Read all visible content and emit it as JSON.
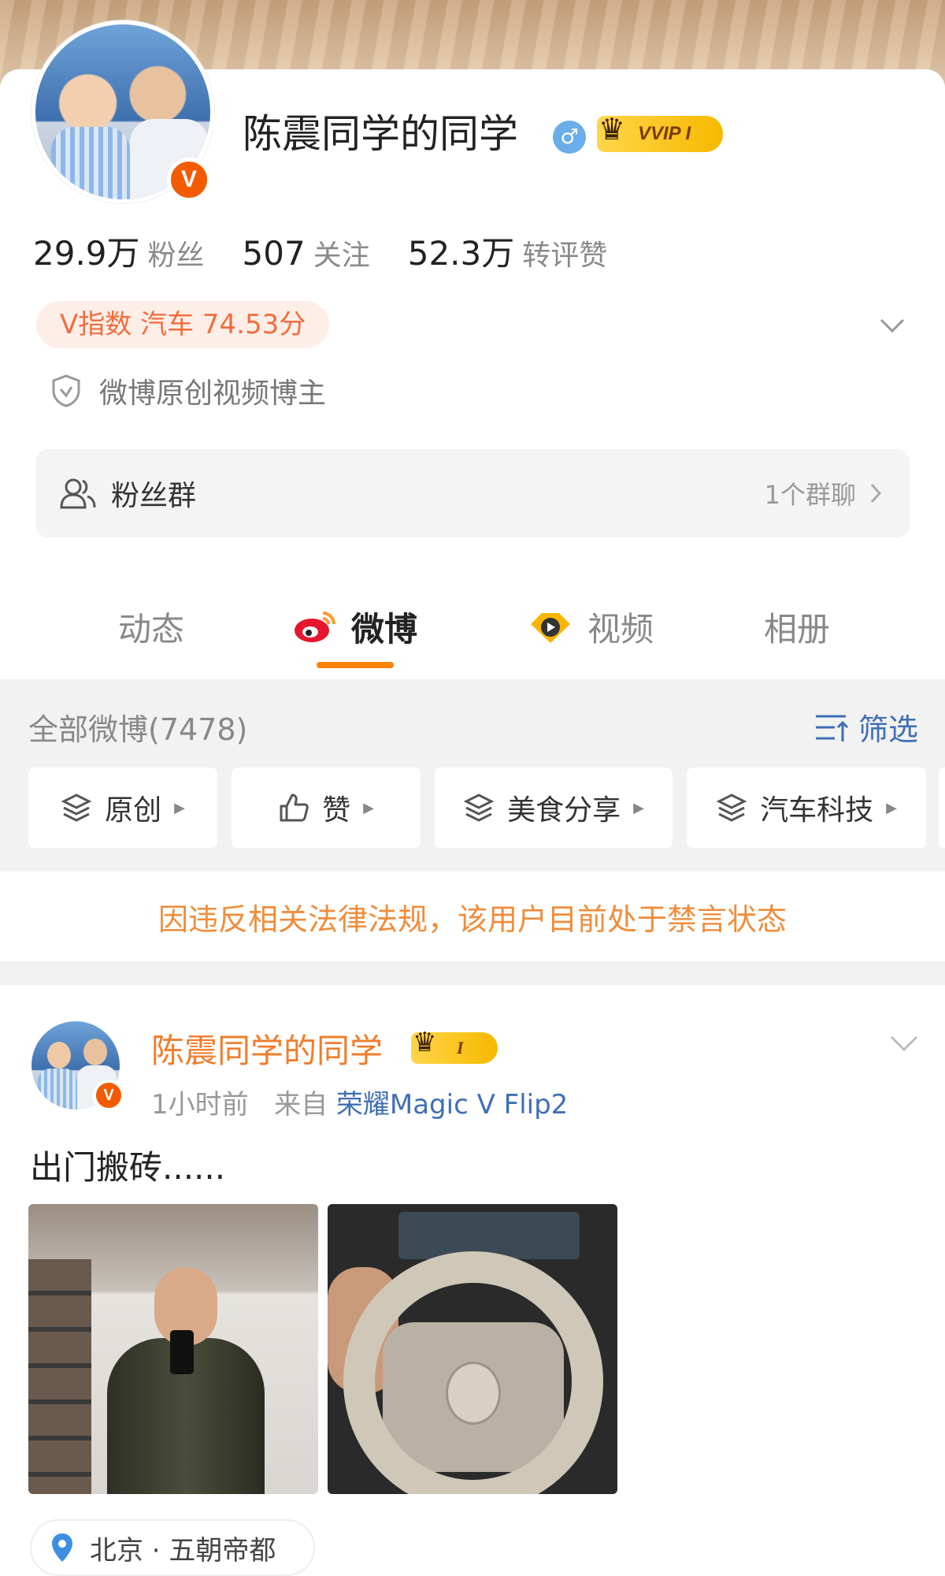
{
  "profile": {
    "name": "陈震同学的同学",
    "gender_icon": "male-icon",
    "gender_symbol": "♂",
    "vip_label": "VVIP I",
    "verified_badge": "V",
    "stats": [
      {
        "value": "29.9万",
        "label": "粉丝"
      },
      {
        "value": "507",
        "label": "关注"
      },
      {
        "value": "52.3万",
        "label": "转评赞"
      }
    ],
    "v_index": "V指数 汽车 74.53分",
    "certification": "微博原创视频博主",
    "fan_group": {
      "label": "粉丝群",
      "count": "1个群聊"
    }
  },
  "tabs": [
    {
      "label": "动态",
      "active": false
    },
    {
      "label": "微博",
      "active": true
    },
    {
      "label": "视频",
      "active": false
    },
    {
      "label": "相册",
      "active": false
    }
  ],
  "feed_header": {
    "count_label": "全部微博(7478)",
    "filter_label": "筛选"
  },
  "chips": [
    {
      "label": "原创",
      "icon": "layers-icon"
    },
    {
      "label": "赞",
      "icon": "thumbs-up-icon"
    },
    {
      "label": "美食分享",
      "icon": "layers-icon"
    },
    {
      "label": "汽车科技",
      "icon": "layers-icon"
    }
  ],
  "notice": "因违反相关法律法规，该用户目前处于禁言状态",
  "post": {
    "author": "陈震同学的同学",
    "vip_label": "I",
    "verified_badge": "V",
    "time": "1小时前",
    "from_label": "来自",
    "device": "荣耀Magic V Flip2",
    "text": "出门搬砖......",
    "location": "北京 · 五朝帝都"
  },
  "colors": {
    "accent": "#ff8200",
    "name_orange": "#f07d2d",
    "link_blue": "#3f6fb5",
    "notice": "#ef8d3c",
    "vindex_bg": "#fdeee8",
    "vindex_text": "#f26d3d"
  }
}
